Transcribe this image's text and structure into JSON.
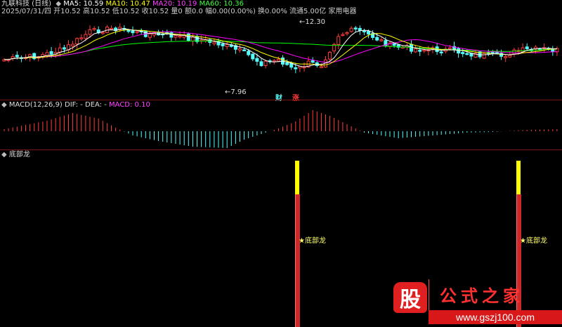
{
  "header": {
    "stock_title": "九联科技 (日线)",
    "ma5_label": "MA5: 10.59",
    "ma10_label": "MA10: 10.47",
    "ma20_label": "MA20: 10.19",
    "ma60_label": "MA60: 10.36",
    "ohlc_line": "2025/07/31/四 开10.52 高10.52 低10.52 收10.52 量0 额0.0 幅0.00(0.00%) 换0.00% 流通5.00亿 家用电器"
  },
  "price_panel": {
    "high_label": "12.30",
    "low_label": "7.96",
    "badge_cai": "财",
    "badge_zhang": "涨"
  },
  "macd_panel": {
    "title": "MACD(12,26,9)",
    "dif_label": "DIF: -",
    "dea_label": "DEA: -",
    "macd_label": "MACD: 0.10"
  },
  "indicator_panel": {
    "title": "底部龙",
    "signal_label_1": "★底部龙",
    "signal_label_2": "★底部龙"
  },
  "watermark": {
    "logo_text": "股",
    "site_name": "公式之家",
    "site_url": "www.gszj100.com"
  },
  "colors": {
    "up": "#ff3c3c",
    "down": "#54fcfc",
    "ma5": "#ffffff",
    "ma10": "#ffff00",
    "ma20": "#ff00ff",
    "ma60": "#00ff00",
    "signal_top": "#ffff00",
    "signal_body": "#cc2020"
  }
}
